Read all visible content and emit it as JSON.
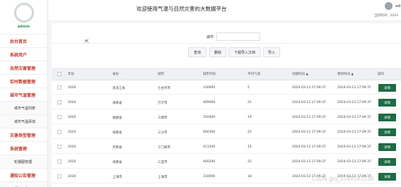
{
  "sidebar": {
    "username": "admin",
    "menu": [
      {
        "label": "后台首页",
        "type": "main"
      },
      {
        "label": "系统用户",
        "type": "main"
      },
      {
        "label": "自然灾害管理",
        "type": "main"
      },
      {
        "label": "实时数据管理",
        "type": "main"
      },
      {
        "label": "城市气温管理",
        "type": "main"
      },
      {
        "label": "城市气温列表",
        "type": "sub"
      },
      {
        "label": "城市气温添加",
        "type": "sub"
      },
      {
        "label": "灾害类型管理",
        "type": "main"
      },
      {
        "label": "系统管理",
        "type": "main"
      },
      {
        "label": "轮播图管理",
        "type": "sub"
      },
      {
        "label": "通知公告管理",
        "type": "main"
      },
      {
        "label": "通知公告",
        "type": "sub"
      }
    ]
  },
  "header": {
    "title": "欢迎使用气温与自然灾害的大数据平台",
    "user_name": "adi",
    "login_time": "当前时间：2024"
  },
  "search": {
    "city_label": "城市",
    "city_value": ""
  },
  "buttons": {
    "query": "查询",
    "delete": "删除",
    "import": "下载导入文档",
    "export": "导入"
  },
  "table": {
    "headers": [
      "年份",
      "省份",
      "城市",
      "城市代码",
      "平均气温",
      "创建时间",
      "更新时间",
      "操作"
    ],
    "sort_marker": "▲",
    "rows": [
      {
        "year": "2020",
        "province": "黑龙江省",
        "city": "七台河市",
        "code": "230900",
        "temp": "5",
        "created": "2024-03-13 17:09:37",
        "updated": "2024-03-13 17:09:37",
        "action": "详情"
      },
      {
        "year": "2020",
        "province": "海南省",
        "city": "万宁市",
        "code": "469006",
        "temp": "25",
        "created": "2024-03-13 17:09:37",
        "updated": "2024-03-13 17:09:37",
        "action": "详情"
      },
      {
        "year": "2020",
        "province": "福建省",
        "city": "三明市",
        "code": "350400",
        "temp": "19",
        "created": "2024-03-13 17:09:37",
        "updated": "2024-03-13 17:09:37",
        "action": "详情"
      },
      {
        "year": "2020",
        "province": "海南省",
        "city": "三沙市",
        "code": "460300",
        "temp": "25",
        "created": "2024-03-13 17:09:37",
        "updated": "2024-03-13 17:09:37",
        "action": "详情"
      },
      {
        "year": "2020",
        "province": "河南省",
        "city": "三门峡市",
        "code": "411200",
        "temp": "14",
        "created": "2024-03-13 17:09:37",
        "updated": "2024-03-13 17:09:37",
        "action": "详情"
      },
      {
        "year": "2020",
        "province": "海南省",
        "city": "三亚市",
        "code": "460200",
        "temp": "25",
        "created": "2024-03-13 17:09:37",
        "updated": "2024-03-13 17:09:37",
        "action": "详情"
      },
      {
        "year": "2020",
        "province": "上海市",
        "city": "上海市",
        "code": "310000",
        "temp": "18",
        "created": "2024-03-13 17:09:37",
        "updated": "2024-03-13 17:09:37",
        "action": "详情"
      }
    ]
  },
  "watermark": "CSDN @q_3548581038"
}
